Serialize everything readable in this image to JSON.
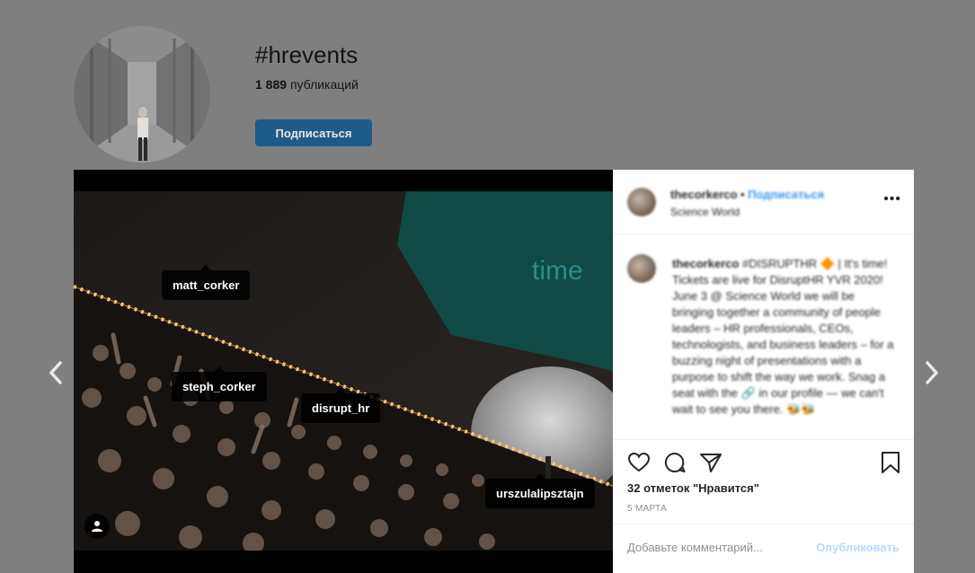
{
  "header": {
    "hashtag": "#hrevents",
    "post_count_number": "1 889",
    "post_count_label": "публикаций",
    "follow_label": "Подписаться"
  },
  "photo_tags": [
    {
      "label": "matt_corker"
    },
    {
      "label": "steph_corker"
    },
    {
      "label": "disrupt_hr"
    },
    {
      "label": "urszulalipsztajn"
    }
  ],
  "photo_screen_text": "time",
  "post": {
    "username": "thecorkerco",
    "separator": "•",
    "follow_label": "Подписаться",
    "location": "Science World",
    "more_label": "•••",
    "caption_user": "thecorkerco",
    "caption_text": "#DISRUPTHR 🔶 | It's time! Tickets are live for DisruptHR YVR 2020! June 3 @ Science World we will be bringing together a community of people leaders – HR professionals, CEOs, technologists, and business leaders – for a buzzing night of presentations with a purpose to shift the way we work. Snag a seat with the 🔗 in our profile — we can't wait to see you there. 🐝🐝",
    "likes": "32 отметок \"Нравится\"",
    "date": "5 МАРТА",
    "comment_placeholder": "Добавьте комментарий...",
    "publish_label": "Опубликовать"
  },
  "icons": [
    "heart-icon",
    "comment-icon",
    "share-icon",
    "bookmark-icon",
    "user-tag-icon",
    "chevron-left-icon",
    "chevron-right-icon"
  ]
}
